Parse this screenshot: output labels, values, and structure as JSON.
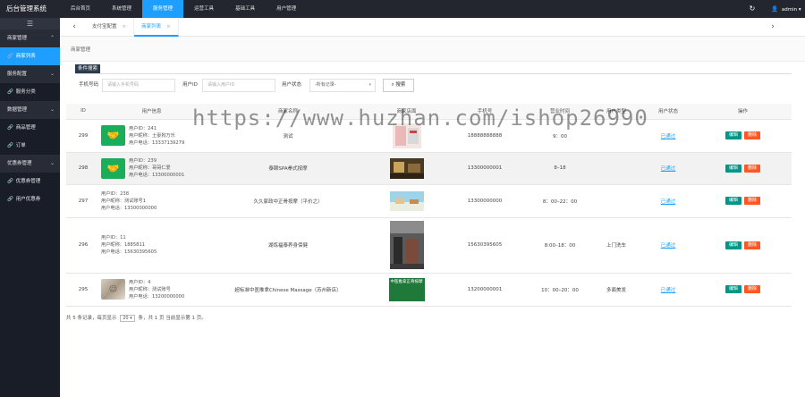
{
  "app": {
    "title": "后台管理系统"
  },
  "topnav": [
    {
      "label": "后台首页"
    },
    {
      "label": "系统管理"
    },
    {
      "label": "服务管理",
      "active": true
    },
    {
      "label": "运营工具"
    },
    {
      "label": "基础工具"
    },
    {
      "label": "用户管理"
    }
  ],
  "header_right": {
    "refresh_icon": "refresh-icon",
    "user": "admin",
    "user_caret": "▾"
  },
  "sidebar": {
    "toggle": "☰",
    "items": [
      {
        "label": "商家管理",
        "type": "parent",
        "chev": "⌃"
      },
      {
        "label": "商家列表",
        "type": "child",
        "active": true
      },
      {
        "label": "服务配置",
        "type": "parent",
        "chev": "⌄"
      },
      {
        "label": "服务分类",
        "type": "child"
      },
      {
        "label": "数据管理",
        "type": "parent",
        "chev": "⌄"
      },
      {
        "label": "商品管理",
        "type": "child"
      },
      {
        "label": "订单",
        "type": "child"
      },
      {
        "label": "优惠券管理",
        "type": "parent",
        "chev": "⌄"
      },
      {
        "label": "优惠券管理",
        "type": "child"
      },
      {
        "label": "用户优惠券",
        "type": "child"
      }
    ]
  },
  "tabs": {
    "left_arrow": "‹",
    "right_arrow": "›",
    "items": [
      {
        "label": "支付宝配置",
        "close": "×"
      },
      {
        "label": "商家列表",
        "close": "×",
        "active": true
      }
    ]
  },
  "breadcrumb": "商家管理",
  "conditions": {
    "title": "条件搜索",
    "phone_label": "手机号码",
    "phone_placeholder": "请输入手机号码",
    "uid_label": "用户ID",
    "uid_placeholder": "请输入用户ID",
    "status_label": "用户状态",
    "status_value": "-所有记录-",
    "search_button": "搜索"
  },
  "table": {
    "headers": [
      "ID",
      "用户信息",
      "商家名称",
      "商家店面",
      "手机号",
      "营业时间",
      "用户类型",
      "用户状态",
      "操作"
    ],
    "rows": [
      {
        "id": "299",
        "avatar": "green",
        "uid": "用户ID：241",
        "nick": "用户昵称：土豪狗万乐",
        "tel": "用户电话：13337139279",
        "name": "测试",
        "phone": "18888888888",
        "hours": "9：00",
        "type": "",
        "status": "已通过",
        "edit": "编辑",
        "del": "删除"
      },
      {
        "id": "298",
        "avatar": "green",
        "uid": "用户ID：239",
        "nick": "用户昵称：哥哥仁爱",
        "tel": "用户电话：13300000001",
        "name": "泰颐SPA拳式按摩",
        "phone": "13300000001",
        "hours": "8–18",
        "type": "",
        "status": "已通过",
        "edit": "编辑",
        "del": "删除"
      },
      {
        "id": "297",
        "avatar": "none",
        "uid": "用户ID：238",
        "nick": "用户昵称：测试账号1",
        "tel": "用户电话：13300000000",
        "name": "久久家政中正骨按摩（平价之）",
        "phone": "13300000000",
        "hours": "8：00–22：00",
        "type": "",
        "status": "已通过",
        "edit": "编辑",
        "del": "删除"
      },
      {
        "id": "296",
        "avatar": "none",
        "uid": "用户ID：11",
        "nick": "用户昵称：1885811",
        "tel": "用户电话：15630395605",
        "name": "湖炼福泰养身保健",
        "phone": "15630395605",
        "hours": "8:00–18：00",
        "type": "上门洗车",
        "status": "已通过",
        "edit": "编辑",
        "del": "删除"
      },
      {
        "id": "295",
        "avatar": "photo",
        "uid": "用户ID：4",
        "nick": "用户昵称：测试账号",
        "tel": "用户电话：13200000000",
        "name": "超标准中医推拿Chinese Massage（苏州新店）",
        "phone": "13200000001",
        "hours": "10：00–20：00",
        "type": "多面美发",
        "status": "已通过",
        "edit": "编辑",
        "del": "删除",
        "thumb_text": "中医推拿正骨按摩"
      }
    ]
  },
  "pager": {
    "prefix": "共 5 条记录，每页显示",
    "page_size": "20",
    "suffix": "条，共 1 页 当前显示第 1 页。"
  },
  "watermark": "https://www.huzhan.com/ishop26990"
}
